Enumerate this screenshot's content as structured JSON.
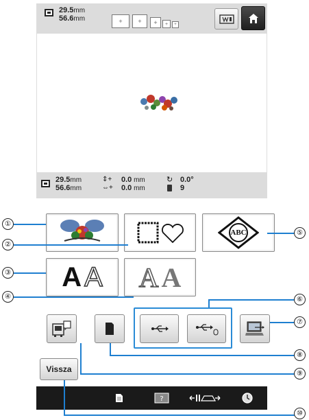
{
  "header": {
    "width_value": "29.5",
    "height_value": "56.6",
    "unit": "mm"
  },
  "info_bar": {
    "width_value": "29.5",
    "height_value": "56.6",
    "unit": "mm",
    "vertical_offset": "0.0",
    "horizontal_offset": "0.0",
    "angle": "0.0°",
    "color_count": "9"
  },
  "pattern_buttons": {
    "character_font_large": "A",
    "character_font_outline": "A",
    "frame_letters": "ABC"
  },
  "back_button_label": "Vissza",
  "callouts": [
    "①",
    "②",
    "③",
    "④",
    "⑤",
    "⑥",
    "⑦",
    "⑧",
    "⑨",
    "⑩"
  ],
  "colors": {
    "accent_blue": "#1e7fd0",
    "toolbar_gray": "#dcdcdc",
    "bottom_bar": "#1a1a1a"
  },
  "icons": [
    "size-icon",
    "frame-display-icon",
    "home-icon",
    "embroidery-pattern-icon",
    "frame-shape-icon",
    "monogram-icon",
    "memory-card-icon",
    "usb-icon",
    "usb-mouse-icon",
    "computer-icon",
    "embroidery-machine-icon",
    "document-icon",
    "help-icon",
    "position-icon",
    "clock-icon"
  ]
}
